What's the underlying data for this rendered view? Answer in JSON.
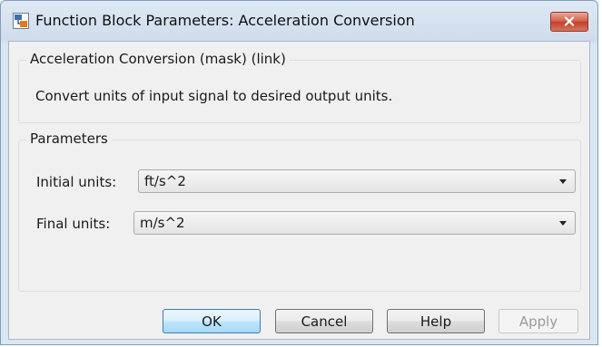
{
  "window": {
    "title": "Function Block Parameters: Acceleration Conversion"
  },
  "description_group": {
    "legend": "Acceleration Conversion (mask) (link)",
    "text": "Convert units of input signal to desired output units."
  },
  "parameters_group": {
    "legend": "Parameters",
    "initial_units": {
      "label": "Initial units:",
      "value": "ft/s^2"
    },
    "final_units": {
      "label": "Final units:",
      "value": "m/s^2"
    }
  },
  "buttons": {
    "ok": "OK",
    "cancel": "Cancel",
    "help": "Help",
    "apply": "Apply"
  },
  "colors": {
    "close_button": "#c0402b",
    "primary_button_border": "#3c7fb1",
    "disabled_text": "#9a9a9a"
  },
  "icons": {
    "app": "simulink-block-icon",
    "close": "close-icon",
    "dropdown": "chevron-down-icon"
  }
}
